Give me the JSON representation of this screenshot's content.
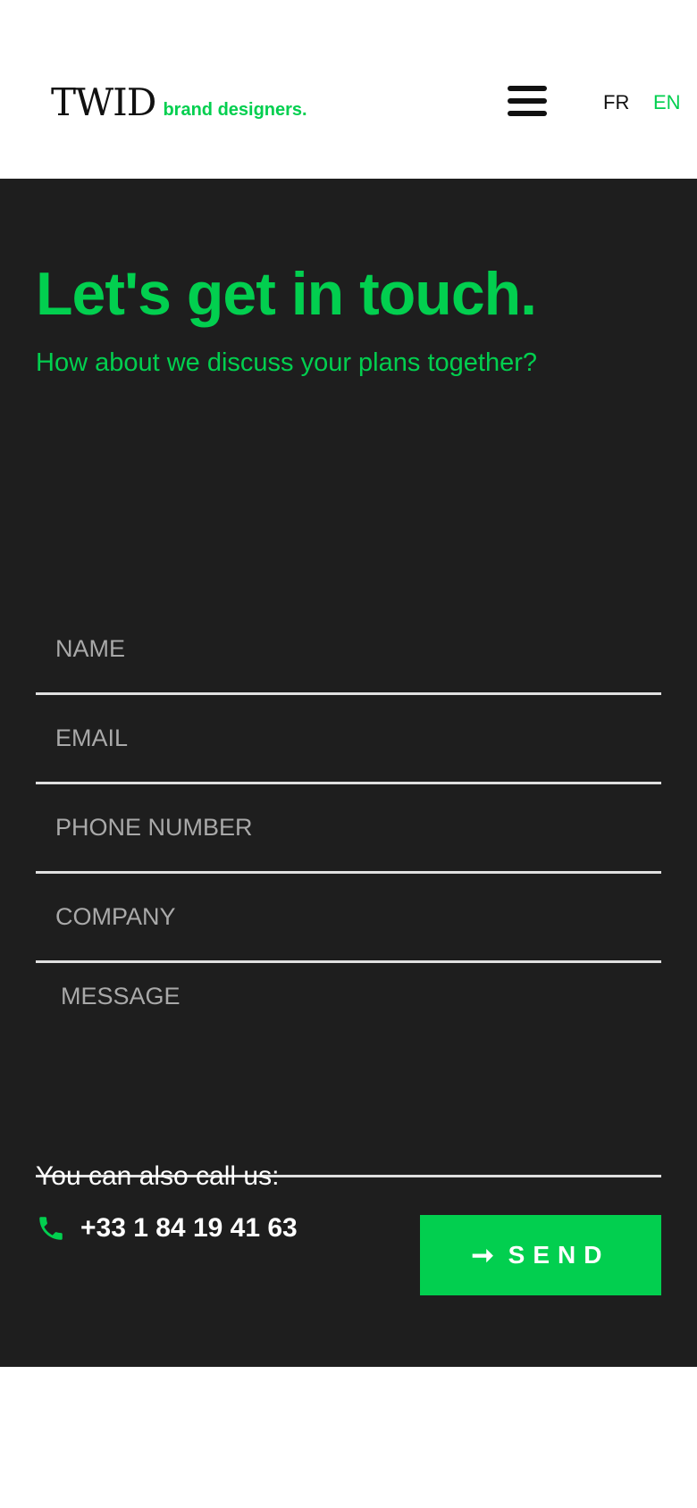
{
  "header": {
    "logo_main": "TWID",
    "logo_sub": "brand designers.",
    "menu_icon": "hamburger-icon",
    "languages": [
      "FR",
      "EN"
    ],
    "active_language": "EN"
  },
  "contact": {
    "title": "Let's get in touch.",
    "subtitle": "How about we discuss your plans together?",
    "fields": {
      "name_placeholder": "NAME",
      "email_placeholder": "EMAIL",
      "phone_placeholder": "PHONE NUMBER",
      "company_placeholder": "COMPANY",
      "message_placeholder": "MESSAGE"
    },
    "send_label": "SEND",
    "send_icon": "arrow-right-icon",
    "call_label": "You can also call us:",
    "phone_icon": "phone-icon",
    "phone_number": "+33 1 84 19 41 63"
  },
  "colors": {
    "accent": "#02cf4f",
    "section_background": "#1e1e1e",
    "header_background": "#ffffff",
    "field_line": "#e0e0e0",
    "placeholder": "#a9a9a9"
  }
}
